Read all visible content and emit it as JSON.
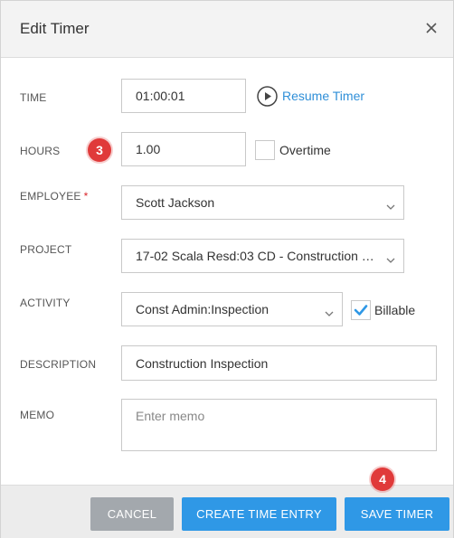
{
  "dialog": {
    "title": "Edit Timer",
    "close_icon": "close-icon"
  },
  "form": {
    "time": {
      "label": "TIME",
      "value": "01:00:01",
      "resume_label": "Resume Timer",
      "resume_icon": "play-circle-icon"
    },
    "hours": {
      "label": "HOURS",
      "value": "1.00",
      "overtime_label": "Overtime",
      "overtime_checked": false
    },
    "employee": {
      "label": "EMPLOYEE",
      "required_marker": "*",
      "value": "Scott Jackson"
    },
    "project": {
      "label": "PROJECT",
      "value": "17-02 Scala Resd:03 CD - Construction D..."
    },
    "activity": {
      "label": "ACTIVITY",
      "value": "Const Admin:Inspection",
      "billable_label": "Billable",
      "billable_checked": true
    },
    "description": {
      "label": "DESCRIPTION",
      "value": "Construction Inspection"
    },
    "memo": {
      "label": "MEMO",
      "placeholder": "Enter memo",
      "value": ""
    }
  },
  "annotations": {
    "step_hours": "3",
    "step_save": "4"
  },
  "footer": {
    "cancel_label": "CANCEL",
    "create_label": "CREATE TIME ENTRY",
    "save_label": "SAVE TIMER"
  },
  "colors": {
    "accent": "#2f98e6",
    "link": "#2f8fd8",
    "badge": "#e03a3a",
    "cancel": "#a3a8ad",
    "required": "#d9262b"
  }
}
